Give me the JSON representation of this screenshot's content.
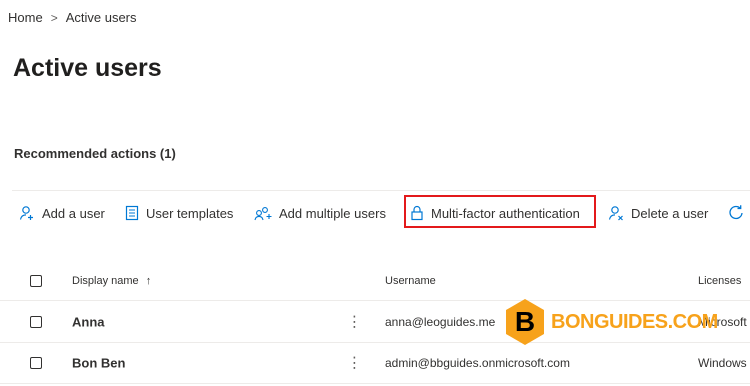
{
  "breadcrumb": {
    "home": "Home",
    "separator": ">",
    "current": "Active users"
  },
  "page_title": "Active users",
  "recommended_actions": "Recommended actions (1)",
  "toolbar": {
    "add_user": "Add a user",
    "user_templates": "User templates",
    "add_multiple_users": "Add multiple users",
    "mfa": "Multi-factor authentication",
    "delete_user": "Delete a user"
  },
  "table": {
    "columns": {
      "display_name": "Display name",
      "sort_indicator": "↑",
      "username": "Username",
      "licenses": "Licenses"
    },
    "rows": [
      {
        "display_name": "Anna",
        "username": "anna@leoguides.me",
        "licenses": "Microsoft"
      },
      {
        "display_name": "Bon Ben",
        "username": "admin@bbguides.onmicrosoft.com",
        "licenses": "Windows"
      }
    ]
  },
  "watermark": {
    "letter": "B",
    "text": "BONGUIDES.COM"
  },
  "colors": {
    "accent": "#0078d4",
    "highlight": "#e3191b",
    "watermark": "#f7a21b"
  }
}
